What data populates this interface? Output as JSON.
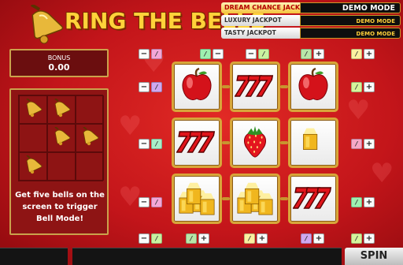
{
  "game": {
    "logo_text": "RING THE BELLS"
  },
  "jackpots": [
    {
      "name": "DREAM CHANCE JACKPOT",
      "value": "DEMO MODE"
    },
    {
      "name": "LUXURY JACKPOT",
      "value": "DEMO MODE"
    },
    {
      "name": "TASTY JACKPOT",
      "value": "DEMO MODE"
    }
  ],
  "bonus": {
    "label": "BONUS",
    "value": "0.00"
  },
  "bell_panel": {
    "info_line1": "Get five bells on the",
    "info_line2": "screen to trigger",
    "info_line3": "Bell Mode!",
    "bells": [
      1,
      1,
      0,
      0,
      1,
      1,
      1,
      0,
      0
    ]
  },
  "reels": [
    [
      "apple",
      "seven",
      "apple"
    ],
    [
      "seven",
      "strawberry",
      "gold"
    ],
    [
      "gold",
      "gold",
      "seven"
    ]
  ],
  "controls": {
    "minus": "−",
    "plus": "+",
    "line_value": "/",
    "colors": [
      "#f4a6d8",
      "#9ef0b0",
      "#c9f2a0",
      "#b8e6a8",
      "#fbf0a0",
      "#d0a8f0",
      "#d6f59c",
      "#a8f0c8",
      "#f7a8c8"
    ]
  },
  "bottom": {
    "spin_label": "SPIN"
  },
  "colors": {
    "gold": "#ffd23a",
    "red": "#c3151a"
  }
}
